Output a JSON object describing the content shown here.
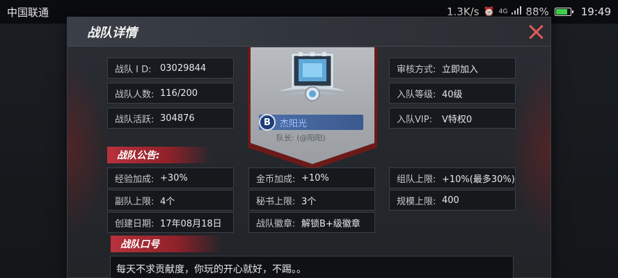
{
  "statusbar": {
    "carrier": "中国联通",
    "speed": "1.3K/s",
    "alarm_icon": "alarm-icon",
    "network": "4G",
    "signal_icon": "signal-icon",
    "battery_pct": "88%",
    "battery_level": 0.88,
    "time": "19:49"
  },
  "panel": {
    "title": "战队详情"
  },
  "left_info": [
    {
      "label": "战队 I D:",
      "value": "03029844"
    },
    {
      "label": "战队人数:",
      "value": "116/200"
    },
    {
      "label": "战队活跃:",
      "value": "304876"
    }
  ],
  "right_info": [
    {
      "label": "审核方式:",
      "value": "立即加入"
    },
    {
      "label": "入队等级:",
      "value": "40级"
    },
    {
      "label": "入队VIP:",
      "value": "V特权0"
    }
  ],
  "emblem": {
    "leader_icon_letter": "B",
    "leader_name": "杰阳光",
    "captain": "队长: (@阳阳)"
  },
  "notice": {
    "title": "战队公告:",
    "bonuses": [
      {
        "label": "经验加成:",
        "value": "+30%"
      },
      {
        "label": "金币加成:",
        "value": "+10%"
      },
      {
        "label": "组队上限:",
        "value": "+10%(最多30%)"
      },
      {
        "label": "副队上限:",
        "value": "4个"
      },
      {
        "label": "秘书上限:",
        "value": "3个"
      },
      {
        "label": "规模上限:",
        "value": "400"
      },
      {
        "label": "创建日期:",
        "value": "17年08月18日"
      },
      {
        "label": "战队徽章:",
        "value": "解锁B+级徽章"
      }
    ]
  },
  "slogan": {
    "title": "战队口号",
    "text": "每天不求贡献度，你玩的开心就好，不踢。。"
  },
  "colors": {
    "accent_red": "#b8323c",
    "close_red": "#e35a5a",
    "leader_blue": "#4d6fa8"
  }
}
